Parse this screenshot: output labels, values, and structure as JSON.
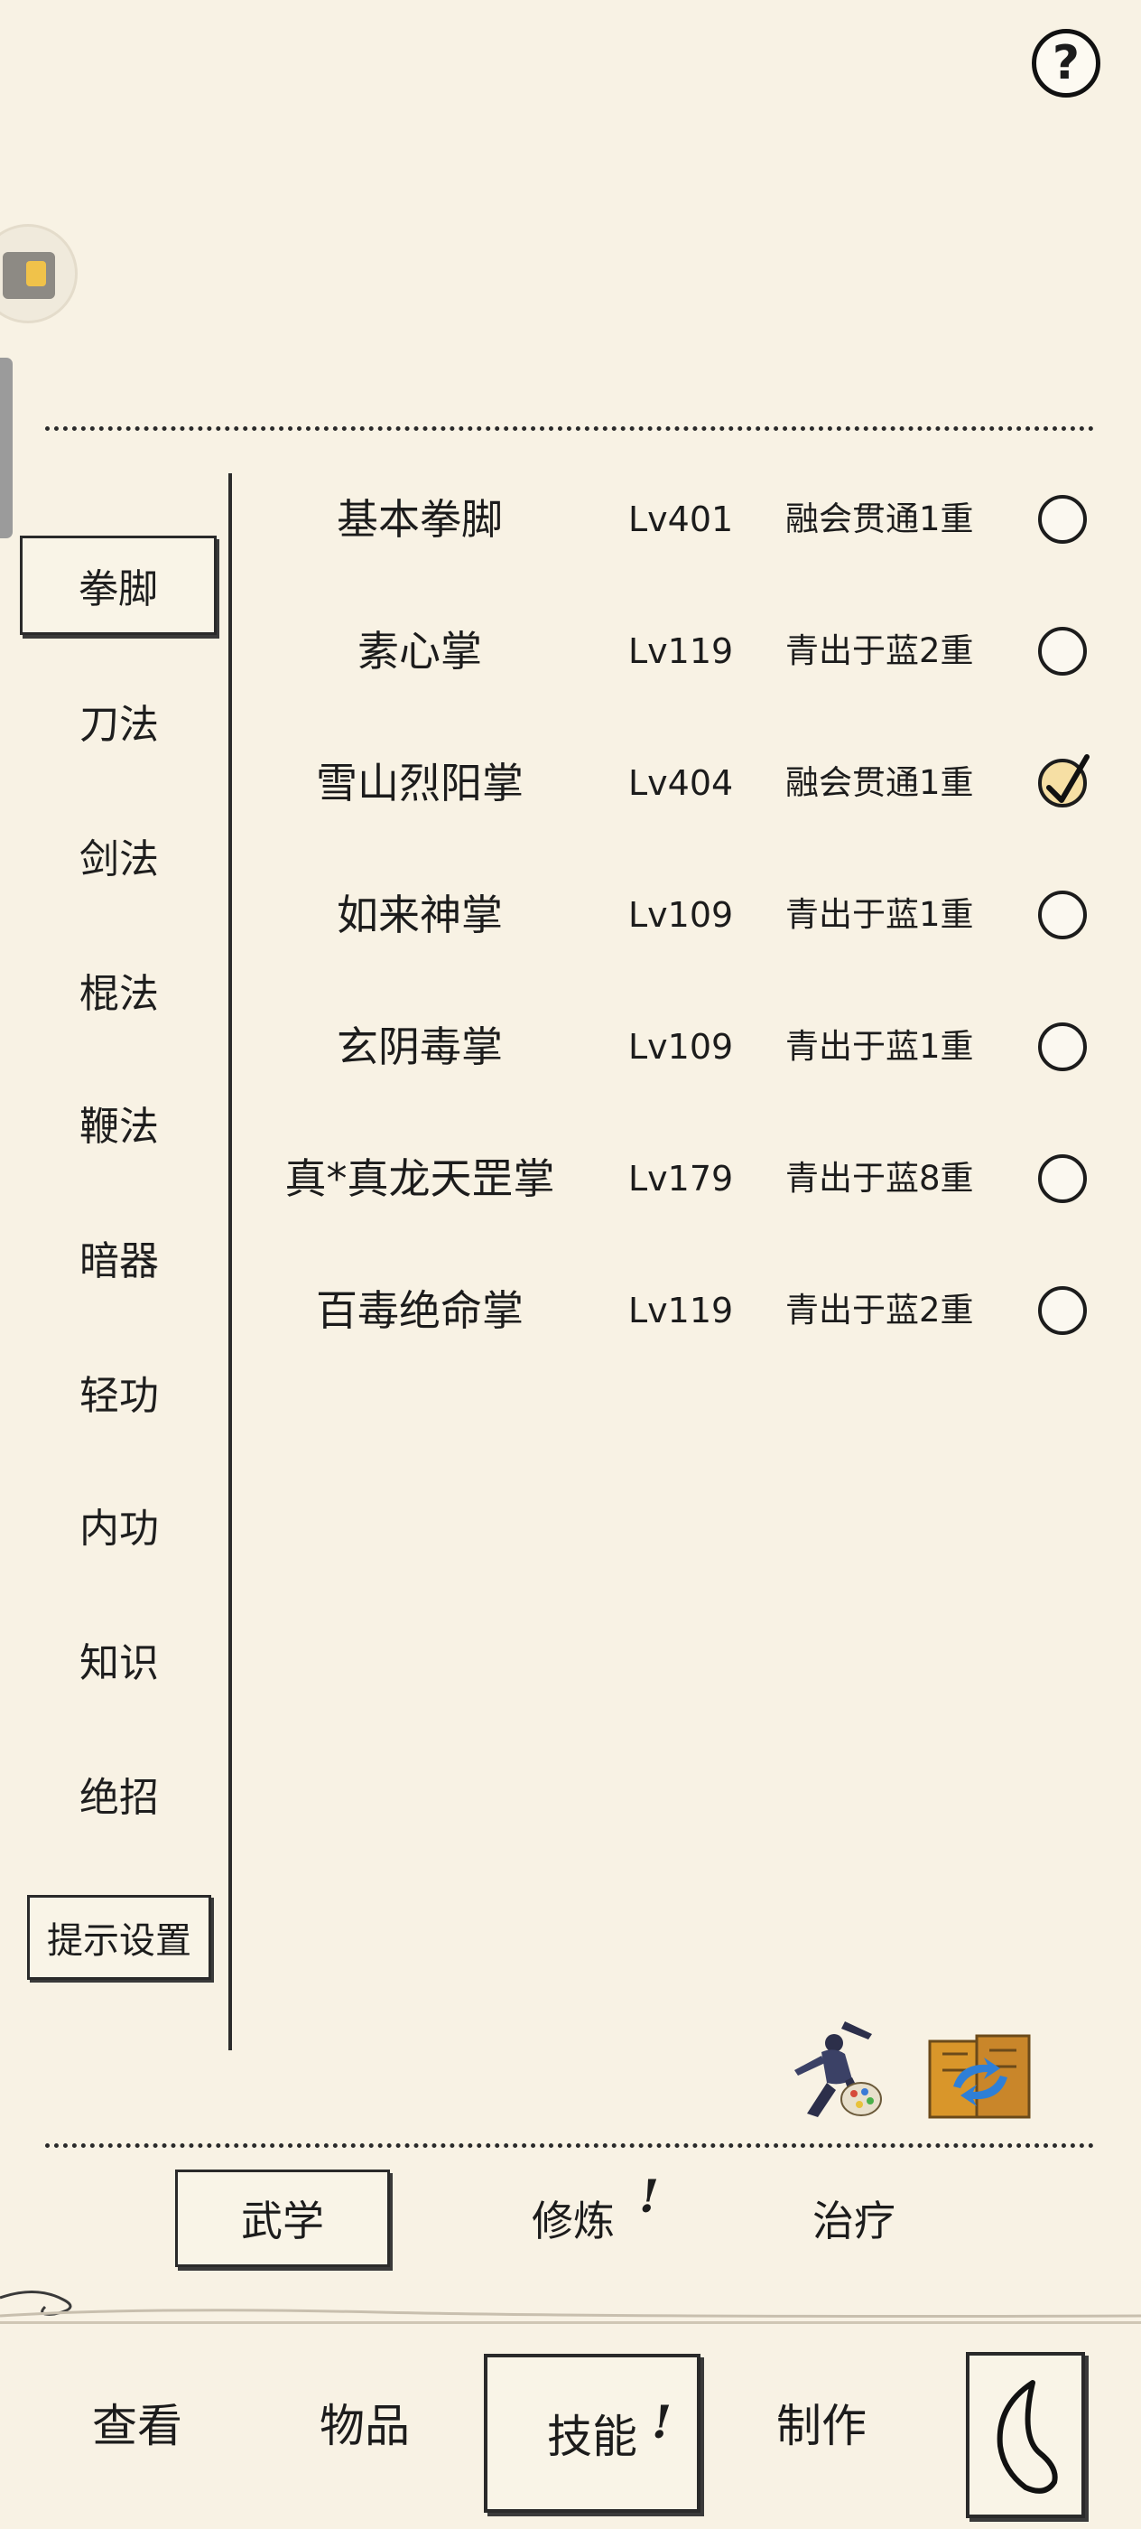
{
  "header": {
    "help_label": "?",
    "help_icon": "question-mark-icon"
  },
  "categories": [
    {
      "label": "拳脚",
      "selected": true
    },
    {
      "label": "刀法"
    },
    {
      "label": "剑法"
    },
    {
      "label": "棍法"
    },
    {
      "label": "鞭法"
    },
    {
      "label": "暗器"
    },
    {
      "label": "轻功"
    },
    {
      "label": "内功"
    },
    {
      "label": "知识"
    },
    {
      "label": "绝招"
    }
  ],
  "hint_settings_label": "提示设置",
  "skills": [
    {
      "name": "基本拳脚",
      "level": "Lv401",
      "rank": "融会贯通1重",
      "checked": false
    },
    {
      "name": "素心掌",
      "level": "Lv119",
      "rank": "青出于蓝2重",
      "checked": false
    },
    {
      "name": "雪山烈阳掌",
      "level": "Lv404",
      "rank": "融会贯通1重",
      "checked": true
    },
    {
      "name": "如来神掌",
      "level": "Lv109",
      "rank": "青出于蓝1重",
      "checked": false
    },
    {
      "name": "玄阴毒掌",
      "level": "Lv109",
      "rank": "青出于蓝1重",
      "checked": false
    },
    {
      "name": "真*真龙天罡掌",
      "level": "Lv179",
      "rank": "青出于蓝8重",
      "checked": false
    },
    {
      "name": "百毒绝命掌",
      "level": "Lv119",
      "rank": "青出于蓝2重",
      "checked": false
    }
  ],
  "subtabs": [
    {
      "label": "武学",
      "selected": true
    },
    {
      "label": "修炼",
      "alert": "!"
    },
    {
      "label": "治疗"
    }
  ],
  "bottom_nav": [
    {
      "label": "查看"
    },
    {
      "label": "物品"
    },
    {
      "label": "技能",
      "selected": true,
      "alert": "!"
    },
    {
      "label": "制作"
    }
  ],
  "colors": {
    "background": "#f8f2e4",
    "ink": "#1c1c1c",
    "checked_fill": "#f6dfa4"
  }
}
